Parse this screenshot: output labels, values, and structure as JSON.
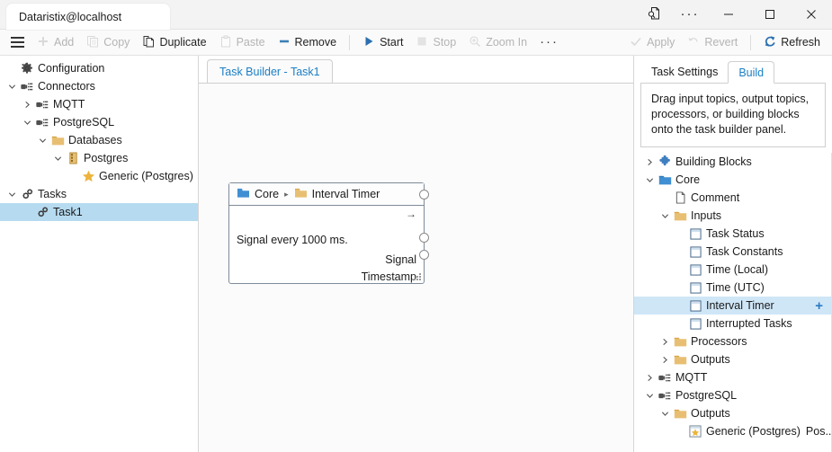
{
  "window": {
    "title": "Dataristix@localhost",
    "buttons": {
      "search_doc": "search-document",
      "more": "···",
      "minimize": "─",
      "maximize": "☐",
      "close": "✕"
    }
  },
  "toolbar": {
    "menu_label": "menu",
    "items": [
      {
        "label": "Add",
        "icon": "plus-icon",
        "enabled": false
      },
      {
        "label": "Copy",
        "icon": "copy-icon",
        "enabled": false
      },
      {
        "label": "Duplicate",
        "icon": "duplicate-icon",
        "enabled": true
      },
      {
        "label": "Paste",
        "icon": "paste-icon",
        "enabled": false
      },
      {
        "label": "Remove",
        "icon": "minus-icon",
        "enabled": true
      }
    ],
    "run_items": [
      {
        "label": "Start",
        "icon": "play-icon",
        "enabled": true
      },
      {
        "label": "Stop",
        "icon": "stop-icon",
        "enabled": false
      },
      {
        "label": "Zoom In",
        "icon": "zoom-in-icon",
        "enabled": false
      }
    ],
    "overflow": "···",
    "right_items": [
      {
        "label": "Apply",
        "icon": "check-icon",
        "enabled": false
      },
      {
        "label": "Revert",
        "icon": "undo-icon",
        "enabled": false
      },
      {
        "label": "Refresh",
        "icon": "refresh-icon",
        "enabled": true
      }
    ]
  },
  "sidebar": {
    "items": [
      {
        "label": "Configuration",
        "icon": "gear-icon",
        "depth": 0,
        "chevron": "none",
        "selected": false
      },
      {
        "label": "Connectors",
        "icon": "plug-icon",
        "depth": 0,
        "chevron": "down",
        "selected": false
      },
      {
        "label": "MQTT",
        "icon": "plug-icon",
        "depth": 1,
        "chevron": "right",
        "selected": false
      },
      {
        "label": "PostgreSQL",
        "icon": "plug-icon",
        "depth": 1,
        "chevron": "down",
        "selected": false
      },
      {
        "label": "Databases",
        "icon": "folder-orange-icon",
        "depth": 2,
        "chevron": "down",
        "selected": false
      },
      {
        "label": "Postgres",
        "icon": "database-icon",
        "depth": 3,
        "chevron": "down",
        "selected": false
      },
      {
        "label": "Generic (Postgres)",
        "icon": "star-icon",
        "depth": 4,
        "chevron": "none",
        "selected": false
      },
      {
        "label": "Tasks",
        "icon": "gears-icon",
        "depth": 0,
        "chevron": "down",
        "selected": false
      },
      {
        "label": "Task1",
        "icon": "gears-icon",
        "depth": 1,
        "chevron": "none",
        "selected": true
      }
    ]
  },
  "center": {
    "tab_label": "Task Builder - Task1",
    "node": {
      "category": "Core",
      "separator": "▸",
      "name": "Interval Timer",
      "description": "Signal every 1000 ms.",
      "top_arrow": "→",
      "ports": [
        {
          "label": "Signal"
        },
        {
          "label": "Timestamp"
        }
      ]
    }
  },
  "right": {
    "tabs": [
      {
        "label": "Task Settings",
        "active": false
      },
      {
        "label": "Build",
        "active": true
      }
    ],
    "hint": "Drag input topics, output topics, processors, or building blocks onto the task builder panel.",
    "tree": [
      {
        "label": "Building Blocks",
        "icon": "puzzle-icon",
        "depth": 0,
        "chevron": "right",
        "selected": false,
        "plus": false
      },
      {
        "label": "Core",
        "icon": "folder-blue-icon",
        "depth": 0,
        "chevron": "down",
        "selected": false,
        "plus": false
      },
      {
        "label": "Comment",
        "icon": "page-icon",
        "depth": 1,
        "chevron": "none",
        "selected": false,
        "plus": false
      },
      {
        "label": "Inputs",
        "icon": "folder-orange-icon",
        "depth": 1,
        "chevron": "down",
        "selected": false,
        "plus": false
      },
      {
        "label": "Task Status",
        "icon": "block-icon",
        "depth": 2,
        "chevron": "none",
        "selected": false,
        "plus": false
      },
      {
        "label": "Task Constants",
        "icon": "block-icon",
        "depth": 2,
        "chevron": "none",
        "selected": false,
        "plus": false
      },
      {
        "label": "Time (Local)",
        "icon": "block-icon",
        "depth": 2,
        "chevron": "none",
        "selected": false,
        "plus": false
      },
      {
        "label": "Time (UTC)",
        "icon": "block-icon",
        "depth": 2,
        "chevron": "none",
        "selected": false,
        "plus": false
      },
      {
        "label": "Interval Timer",
        "icon": "block-icon",
        "depth": 2,
        "chevron": "none",
        "selected": true,
        "plus": true
      },
      {
        "label": "Interrupted Tasks",
        "icon": "block-icon",
        "depth": 2,
        "chevron": "none",
        "selected": false,
        "plus": false
      },
      {
        "label": "Processors",
        "icon": "folder-orange-icon",
        "depth": 1,
        "chevron": "right",
        "selected": false,
        "plus": false
      },
      {
        "label": "Outputs",
        "icon": "folder-orange-icon",
        "depth": 1,
        "chevron": "right",
        "selected": false,
        "plus": false
      },
      {
        "label": "MQTT",
        "icon": "plug-icon",
        "depth": 0,
        "chevron": "right",
        "selected": false,
        "plus": false
      },
      {
        "label": "PostgreSQL",
        "icon": "plug-icon",
        "depth": 0,
        "chevron": "down",
        "selected": false,
        "plus": false
      },
      {
        "label": "Outputs",
        "icon": "folder-orange-icon",
        "depth": 1,
        "chevron": "down",
        "selected": false,
        "plus": false
      },
      {
        "label": "Generic (Postgres)",
        "icon": "star-block-icon",
        "depth": 2,
        "chevron": "none",
        "selected": false,
        "plus": false,
        "trailing": "Pos..."
      }
    ]
  },
  "colors": {
    "accent": "#1b7fc4",
    "selection": "#b6dbf0",
    "selection_right": "#cfe6f7",
    "folder_orange": "#e8b457",
    "folder_blue": "#3f8fd2",
    "plug_gray": "#4f4f4f",
    "star_gold": "#eeb33c",
    "plus_blue": "#2b7cc0"
  }
}
